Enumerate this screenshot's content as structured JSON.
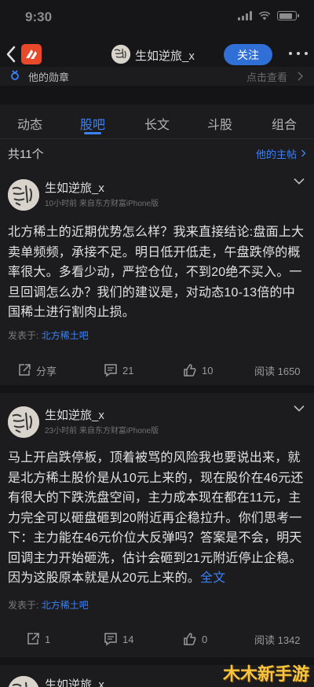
{
  "status_bar": {
    "time": "9:30"
  },
  "nav": {
    "title": "生如逆旅_x",
    "follow_label": "关注"
  },
  "medal": {
    "label": "他的勋章",
    "more": "点击查看"
  },
  "tabs": [
    "动态",
    "股吧",
    "长文",
    "斗股",
    "组合"
  ],
  "active_tab": "股吧",
  "list": {
    "count_text": "共11个",
    "his_posts": "他的主帖"
  },
  "posts": [
    {
      "name": "生如逆旅_x",
      "meta": "10小时前 来自东方财富iPhone版",
      "body": "北方稀土的近期优势怎么样？我来直接结论:盘面上大卖单频频，承接不足。明日低开低走，午盘跌停的概率很大。多看少动，严控仓位，不到20绝不买入。一旦回调怎么办？我们的建议是，对动态10-13倍的中国稀土进行割肉止损。",
      "from_prefix": "发表于:",
      "from_bar": "北方稀土吧",
      "share": "分享",
      "comments": "21",
      "likes": "10",
      "views": "阅读 1650"
    },
    {
      "name": "生如逆旅_x",
      "meta": "23小时前 来自东方财富iPhone版",
      "body": "马上开启跌停板，顶着被骂的风险我也要说出来，就是北方稀土股价是从10元上来的，现在股价在46元还有很大的下跌洗盘空间，主力成本现在都在11元，主力完全可以砸盘砸到20附近再企稳拉升。你们思考一下：主力能在46元价位大反弹吗？答案是不会，明天回调主力开始砸洗，估计会砸到21元附近停止企稳。因为这股原本就是从20元上来的。",
      "full_text": "全文",
      "from_prefix": "发表于:",
      "from_bar": "北方稀土吧",
      "share": "1",
      "comments": "14",
      "likes": "0",
      "views": "阅读 1342"
    },
    {
      "name": "生如逆旅_x"
    }
  ],
  "watermark": "木木新手游"
}
